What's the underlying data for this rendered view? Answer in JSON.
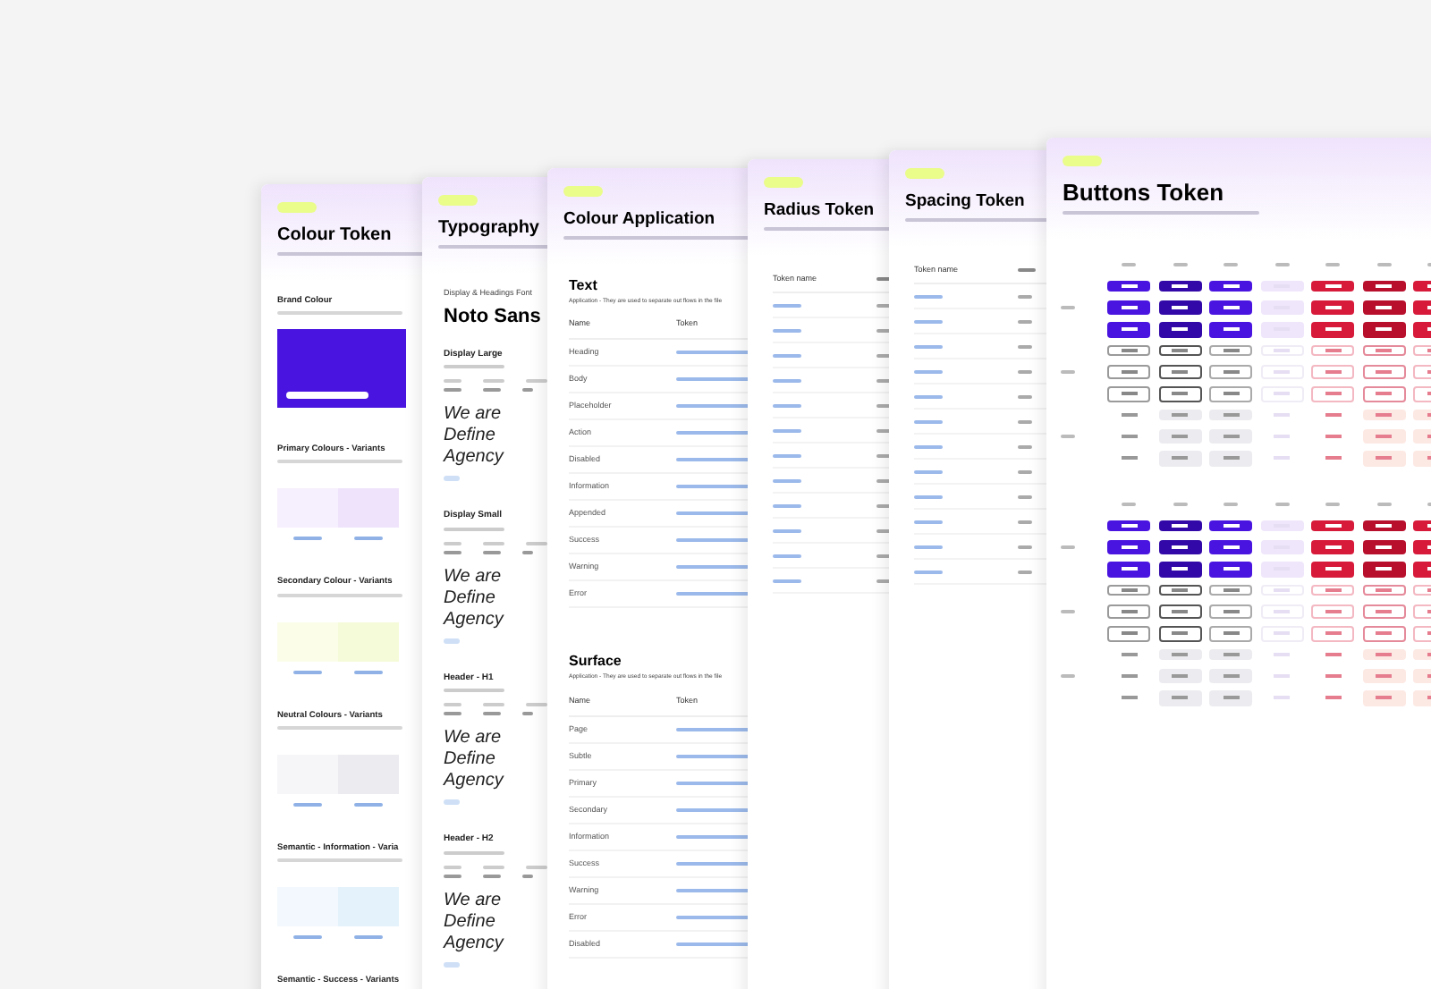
{
  "cards": [
    {
      "kind": "colour_token",
      "title": "Colour Token",
      "sections": [
        {
          "kind": "brand",
          "heading": "Brand Colour"
        },
        {
          "kind": "variants",
          "heading": "Primary Colours - Variants"
        },
        {
          "kind": "variants",
          "heading": "Secondary Colour - Variants"
        },
        {
          "kind": "variants",
          "heading": "Neutral Colours - Variants"
        },
        {
          "kind": "variants",
          "heading": "Semantic - Information - Varia"
        },
        {
          "kind": "heading_only",
          "heading": "Semantic - Success - Variants"
        }
      ]
    },
    {
      "kind": "typography",
      "title": "Typography",
      "font_label": "Display & Headings Font",
      "font_name": "Noto Sans",
      "styles": [
        {
          "name": "Display Large",
          "sample": "We are Define Agency"
        },
        {
          "name": "Display Small",
          "sample": "We are Define Agency"
        },
        {
          "name": "Header - H1",
          "sample": "We are Define Agency"
        },
        {
          "name": "Header - H2",
          "sample": "We are Define Agency"
        }
      ]
    },
    {
      "kind": "colour_application",
      "title": "Colour Application",
      "groups": [
        {
          "heading": "Text",
          "caption": "Application - They are used to separate out flows in the file",
          "columns": [
            "Name",
            "Token"
          ],
          "rows": [
            "Heading",
            "Body",
            "Placeholder",
            "Action",
            "Disabled",
            "Information",
            "Appended",
            "Success",
            "Warning",
            "Error"
          ]
        },
        {
          "heading": "Surface",
          "caption": "Application - They are used to separate out flows in the file",
          "columns": [
            "Name",
            "Token"
          ],
          "rows": [
            "Page",
            "Subtle",
            "Primary",
            "Secondary",
            "Information",
            "Success",
            "Warning",
            "Error",
            "Disabled"
          ]
        }
      ]
    },
    {
      "kind": "token_table",
      "title": "Radius Token",
      "columns": [
        "Token name"
      ]
    },
    {
      "kind": "token_table",
      "title": "Spacing Token",
      "columns": [
        "Token name"
      ]
    },
    {
      "kind": "buttons",
      "title": "Buttons Token"
    }
  ]
}
